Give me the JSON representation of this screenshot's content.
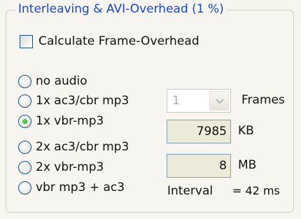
{
  "group": {
    "title": "Interleaving & AVI-Overhead (1 %)"
  },
  "calculate": {
    "label": "Calculate  Frame-Overhead",
    "checked": false
  },
  "audio_options": [
    {
      "label": "no audio",
      "selected": false
    },
    {
      "label": "1x ac3/cbr mp3",
      "selected": false
    },
    {
      "label": "1x vbr-mp3",
      "selected": true
    },
    {
      "label": "2x ac3/cbr mp3",
      "selected": false
    },
    {
      "label": "2x vbr-mp3",
      "selected": false
    },
    {
      "label": "vbr mp3 + ac3",
      "selected": false
    }
  ],
  "frames": {
    "value": "1",
    "unit": "Frames"
  },
  "size_kb": {
    "value": "7985",
    "unit": "KB"
  },
  "size_mb": {
    "value": "8",
    "unit": "MB"
  },
  "interval": {
    "label": "Interval",
    "value": "= 42 ms"
  },
  "colors": {
    "title": "#1a44d9",
    "radio_selected": "#2aa21f",
    "field_bg": "#ecead9"
  }
}
